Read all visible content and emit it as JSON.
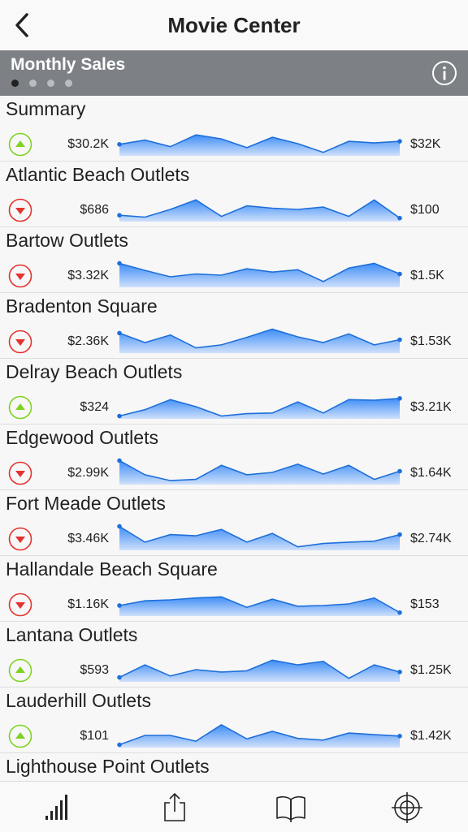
{
  "nav": {
    "title": "Movie Center",
    "back_icon": "back-chevron-icon"
  },
  "section": {
    "title": "Monthly Sales",
    "page_count": 4,
    "active_page": 0,
    "info_icon": "info-icon"
  },
  "colors": {
    "up": "#7ed321",
    "down": "#e4322e",
    "spark_line": "#1e6fd9",
    "spark_fill_top": "#3e8ef7",
    "header_bg": "#7d8186"
  },
  "rows": [
    {
      "name": "Summary",
      "trend": "up",
      "start": "$30.2K",
      "end": "$32K",
      "points": [
        0.58,
        0.4,
        0.68,
        0.18,
        0.35,
        0.72,
        0.28,
        0.55,
        0.92,
        0.45,
        0.52,
        0.45
      ]
    },
    {
      "name": "Atlantic Beach Outlets",
      "trend": "down",
      "start": "$686",
      "end": "$100",
      "points": [
        0.8,
        0.88,
        0.55,
        0.15,
        0.85,
        0.4,
        0.5,
        0.55,
        0.45,
        0.85,
        0.15,
        0.92
      ]
    },
    {
      "name": "Bartow Outlets",
      "trend": "down",
      "start": "$3.32K",
      "end": "$1.5K",
      "points": [
        0.05,
        0.35,
        0.62,
        0.5,
        0.55,
        0.28,
        0.42,
        0.32,
        0.82,
        0.25,
        0.05,
        0.5
      ]
    },
    {
      "name": "Bradenton Square",
      "trend": "down",
      "start": "$2.36K",
      "end": "$1.53K",
      "points": [
        0.22,
        0.62,
        0.3,
        0.85,
        0.72,
        0.4,
        0.05,
        0.38,
        0.62,
        0.25,
        0.72,
        0.5
      ]
    },
    {
      "name": "Delray Beach Outlets",
      "trend": "up",
      "start": "$324",
      "end": "$3.21K",
      "points": [
        0.95,
        0.68,
        0.25,
        0.55,
        0.95,
        0.85,
        0.82,
        0.35,
        0.82,
        0.25,
        0.28,
        0.2
      ]
    },
    {
      "name": "Edgewood Outlets",
      "trend": "down",
      "start": "$2.99K",
      "end": "$1.64K",
      "points": [
        0.05,
        0.65,
        0.9,
        0.85,
        0.25,
        0.65,
        0.55,
        0.2,
        0.62,
        0.25,
        0.85,
        0.5
      ]
    },
    {
      "name": "Fort Meade Outlets",
      "trend": "down",
      "start": "$3.46K",
      "end": "$2.74K",
      "points": [
        0.05,
        0.72,
        0.4,
        0.45,
        0.18,
        0.72,
        0.35,
        0.92,
        0.78,
        0.72,
        0.68,
        0.4
      ]
    },
    {
      "name": "Hallandale Beach Square",
      "trend": "down",
      "start": "$1.16K",
      "end": "$153",
      "points": [
        0.62,
        0.42,
        0.38,
        0.3,
        0.25,
        0.7,
        0.35,
        0.65,
        0.62,
        0.55,
        0.3,
        0.92
      ]
    },
    {
      "name": "Lantana Outlets",
      "trend": "up",
      "start": "$593",
      "end": "$1.25K",
      "points": [
        0.88,
        0.35,
        0.82,
        0.55,
        0.65,
        0.6,
        0.15,
        0.35,
        0.2,
        0.92,
        0.35,
        0.65
      ]
    },
    {
      "name": "Lauderhill Outlets",
      "trend": "up",
      "start": "$101",
      "end": "$1.42K",
      "points": [
        0.95,
        0.55,
        0.55,
        0.8,
        0.1,
        0.7,
        0.38,
        0.68,
        0.75,
        0.45,
        0.52,
        0.58
      ]
    },
    {
      "name": "Lighthouse Point Outlets",
      "partial": true
    }
  ],
  "tabs": [
    {
      "icon": "signal-bars-icon"
    },
    {
      "icon": "share-icon"
    },
    {
      "icon": "book-icon"
    },
    {
      "icon": "target-icon"
    }
  ]
}
